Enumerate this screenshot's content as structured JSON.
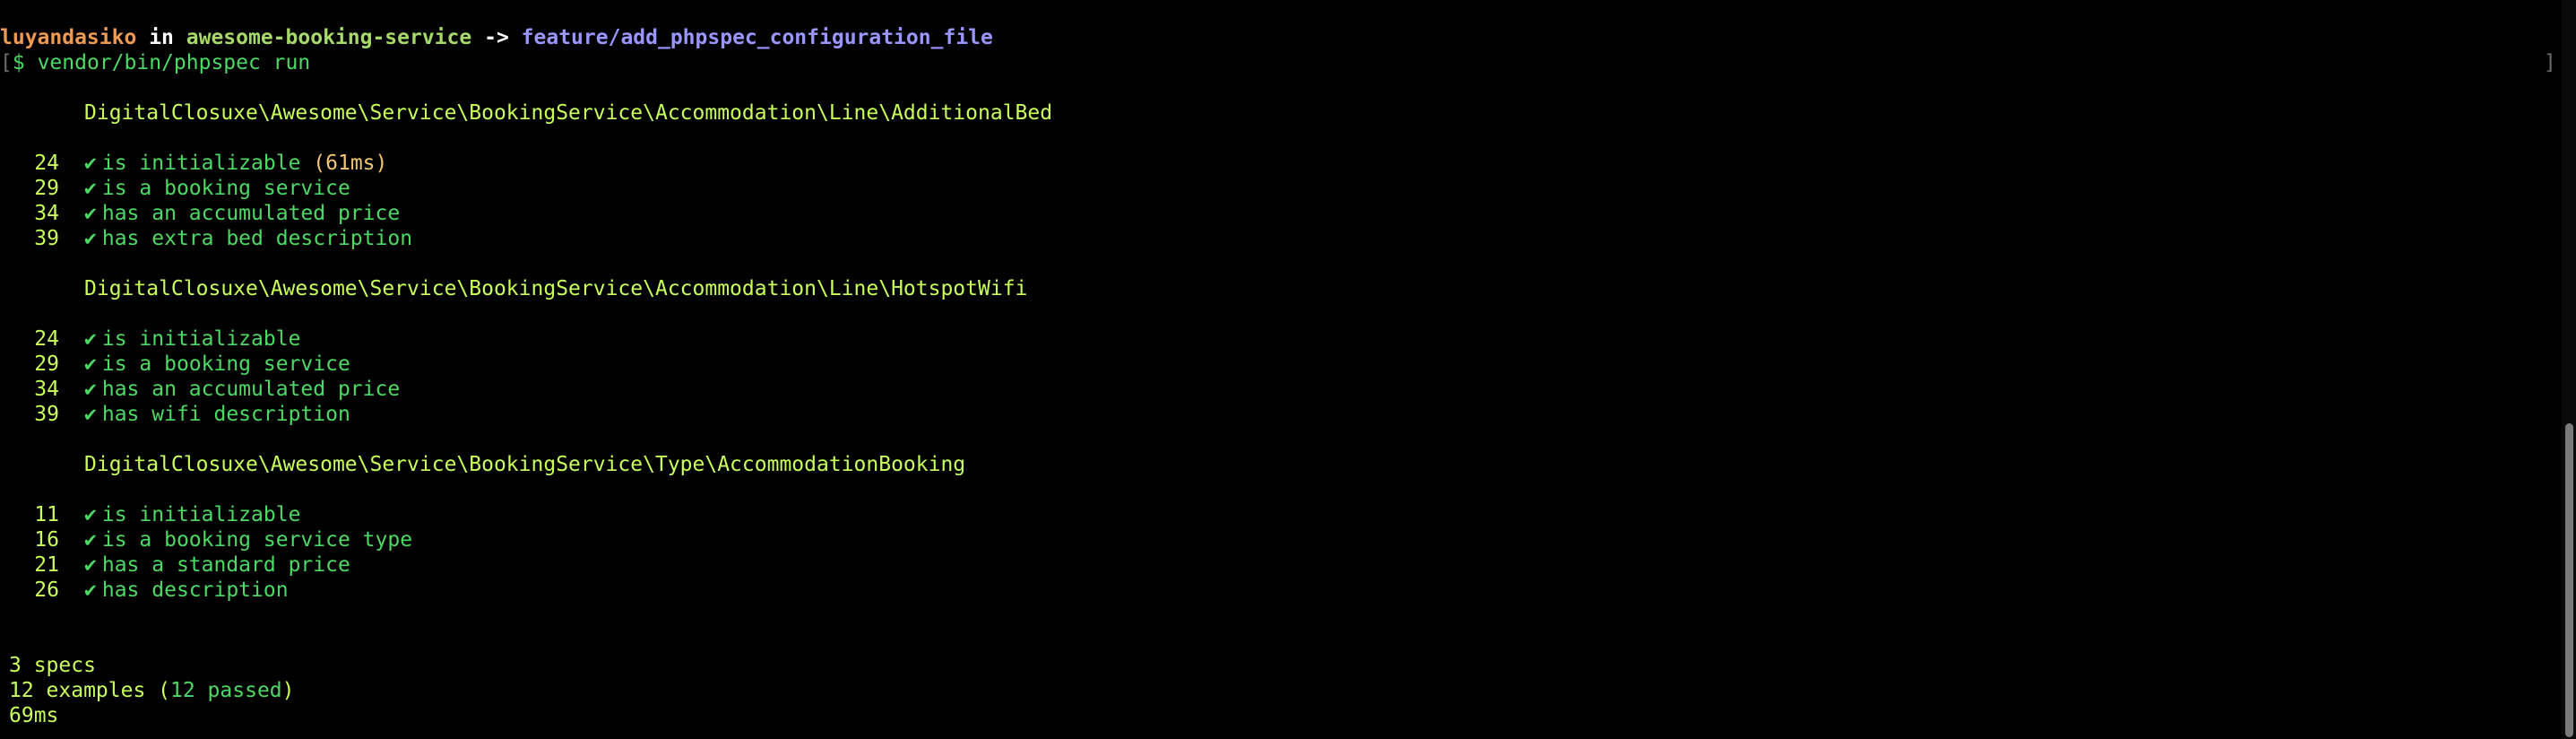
{
  "prompt": {
    "user": "luyandasiko",
    "in_word": "in",
    "directory": "awesome-booking-service",
    "arrow": "->",
    "branch": "feature/add_phpspec_configuration_file"
  },
  "command": {
    "prefix": "$",
    "text": "vendor/bin/phpspec run",
    "right_bracket": "]",
    "left_bracket": "["
  },
  "specs": [
    {
      "title": "DigitalClosuxe\\Awesome\\Service\\BookingService\\Accommodation\\Line\\AdditionalBed",
      "examples": [
        {
          "line": "24",
          "check": "✔",
          "label": "is initializable",
          "time": "(61ms)"
        },
        {
          "line": "29",
          "check": "✔",
          "label": "is a booking service",
          "time": ""
        },
        {
          "line": "34",
          "check": "✔",
          "label": "has an accumulated price",
          "time": ""
        },
        {
          "line": "39",
          "check": "✔",
          "label": "has extra bed description",
          "time": ""
        }
      ]
    },
    {
      "title": "DigitalClosuxe\\Awesome\\Service\\BookingService\\Accommodation\\Line\\HotspotWifi",
      "examples": [
        {
          "line": "24",
          "check": "✔",
          "label": "is initializable",
          "time": ""
        },
        {
          "line": "29",
          "check": "✔",
          "label": "is a booking service",
          "time": ""
        },
        {
          "line": "34",
          "check": "✔",
          "label": "has an accumulated price",
          "time": ""
        },
        {
          "line": "39",
          "check": "✔",
          "label": "has wifi description",
          "time": ""
        }
      ]
    },
    {
      "title": "DigitalClosuxe\\Awesome\\Service\\BookingService\\Type\\AccommodationBooking",
      "examples": [
        {
          "line": "11",
          "check": "✔",
          "label": "is initializable",
          "time": ""
        },
        {
          "line": "16",
          "check": "✔",
          "label": "is a booking service type",
          "time": ""
        },
        {
          "line": "21",
          "check": "✔",
          "label": "has a standard price",
          "time": ""
        },
        {
          "line": "26",
          "check": "✔",
          "label": "has description",
          "time": ""
        }
      ]
    }
  ],
  "summary": {
    "specs": "3 specs",
    "examples_prefix": "12 examples (",
    "examples_passed": "12 passed",
    "examples_suffix": ")",
    "duration": "69ms"
  },
  "colors": {
    "background": "#000000",
    "user": "#ef9a52",
    "directory": "#a6d96a",
    "branch": "#9a96ff",
    "pass": "#4cd964",
    "spec_title": "#c8ff5a",
    "timing": "#f0c674"
  },
  "icons": {
    "check": "check-icon"
  }
}
